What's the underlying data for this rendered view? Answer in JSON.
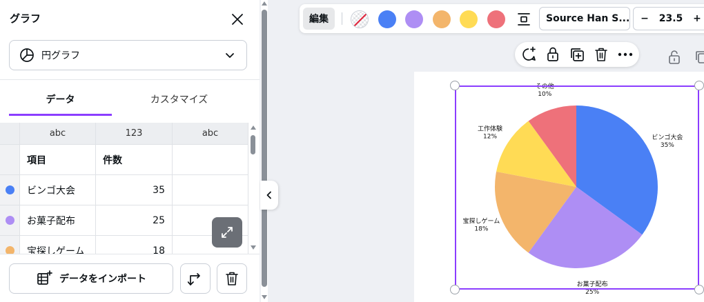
{
  "panel": {
    "title": "グラフ",
    "close_icon": "close-icon",
    "chart_type": {
      "label": "円グラフ",
      "icon": "pie-chart-icon"
    },
    "tabs": [
      "データ",
      "カスタマイズ"
    ],
    "active_tab": "データ",
    "table": {
      "types": [
        "abc",
        "123",
        "abc"
      ],
      "headers": [
        "項目",
        "件数",
        ""
      ],
      "rows": [
        {
          "label": "ビンゴ大会",
          "value": "35",
          "color": "#4a80f5"
        },
        {
          "label": "お菓子配布",
          "value": "25",
          "color": "#ae8ef4"
        },
        {
          "label": "宝探しゲーム",
          "value": "18",
          "color": "#f3b56b"
        }
      ]
    },
    "import_button": "データをインポート"
  },
  "toolbar": {
    "edit_label": "編集",
    "swatches": [
      "#4a80f5",
      "#ae8ef4",
      "#f3b56b",
      "#ffdb55",
      "#ee717a"
    ],
    "font": "Source Han S...",
    "font_size": "23.5",
    "minus": "−",
    "plus": "+"
  },
  "chart_data": {
    "type": "pie",
    "categories": [
      "ビンゴ大会",
      "お菓子配布",
      "宝探しゲーム",
      "工作体験",
      "その他"
    ],
    "values": [
      35,
      25,
      18,
      12,
      10
    ],
    "labels": [
      "35%",
      "25%",
      "18%",
      "12%",
      "10%"
    ],
    "colors": [
      "#4a80f5",
      "#ae8ef4",
      "#f3b56b",
      "#ffdb55",
      "#ee717a"
    ],
    "title": "",
    "legend": "none"
  }
}
